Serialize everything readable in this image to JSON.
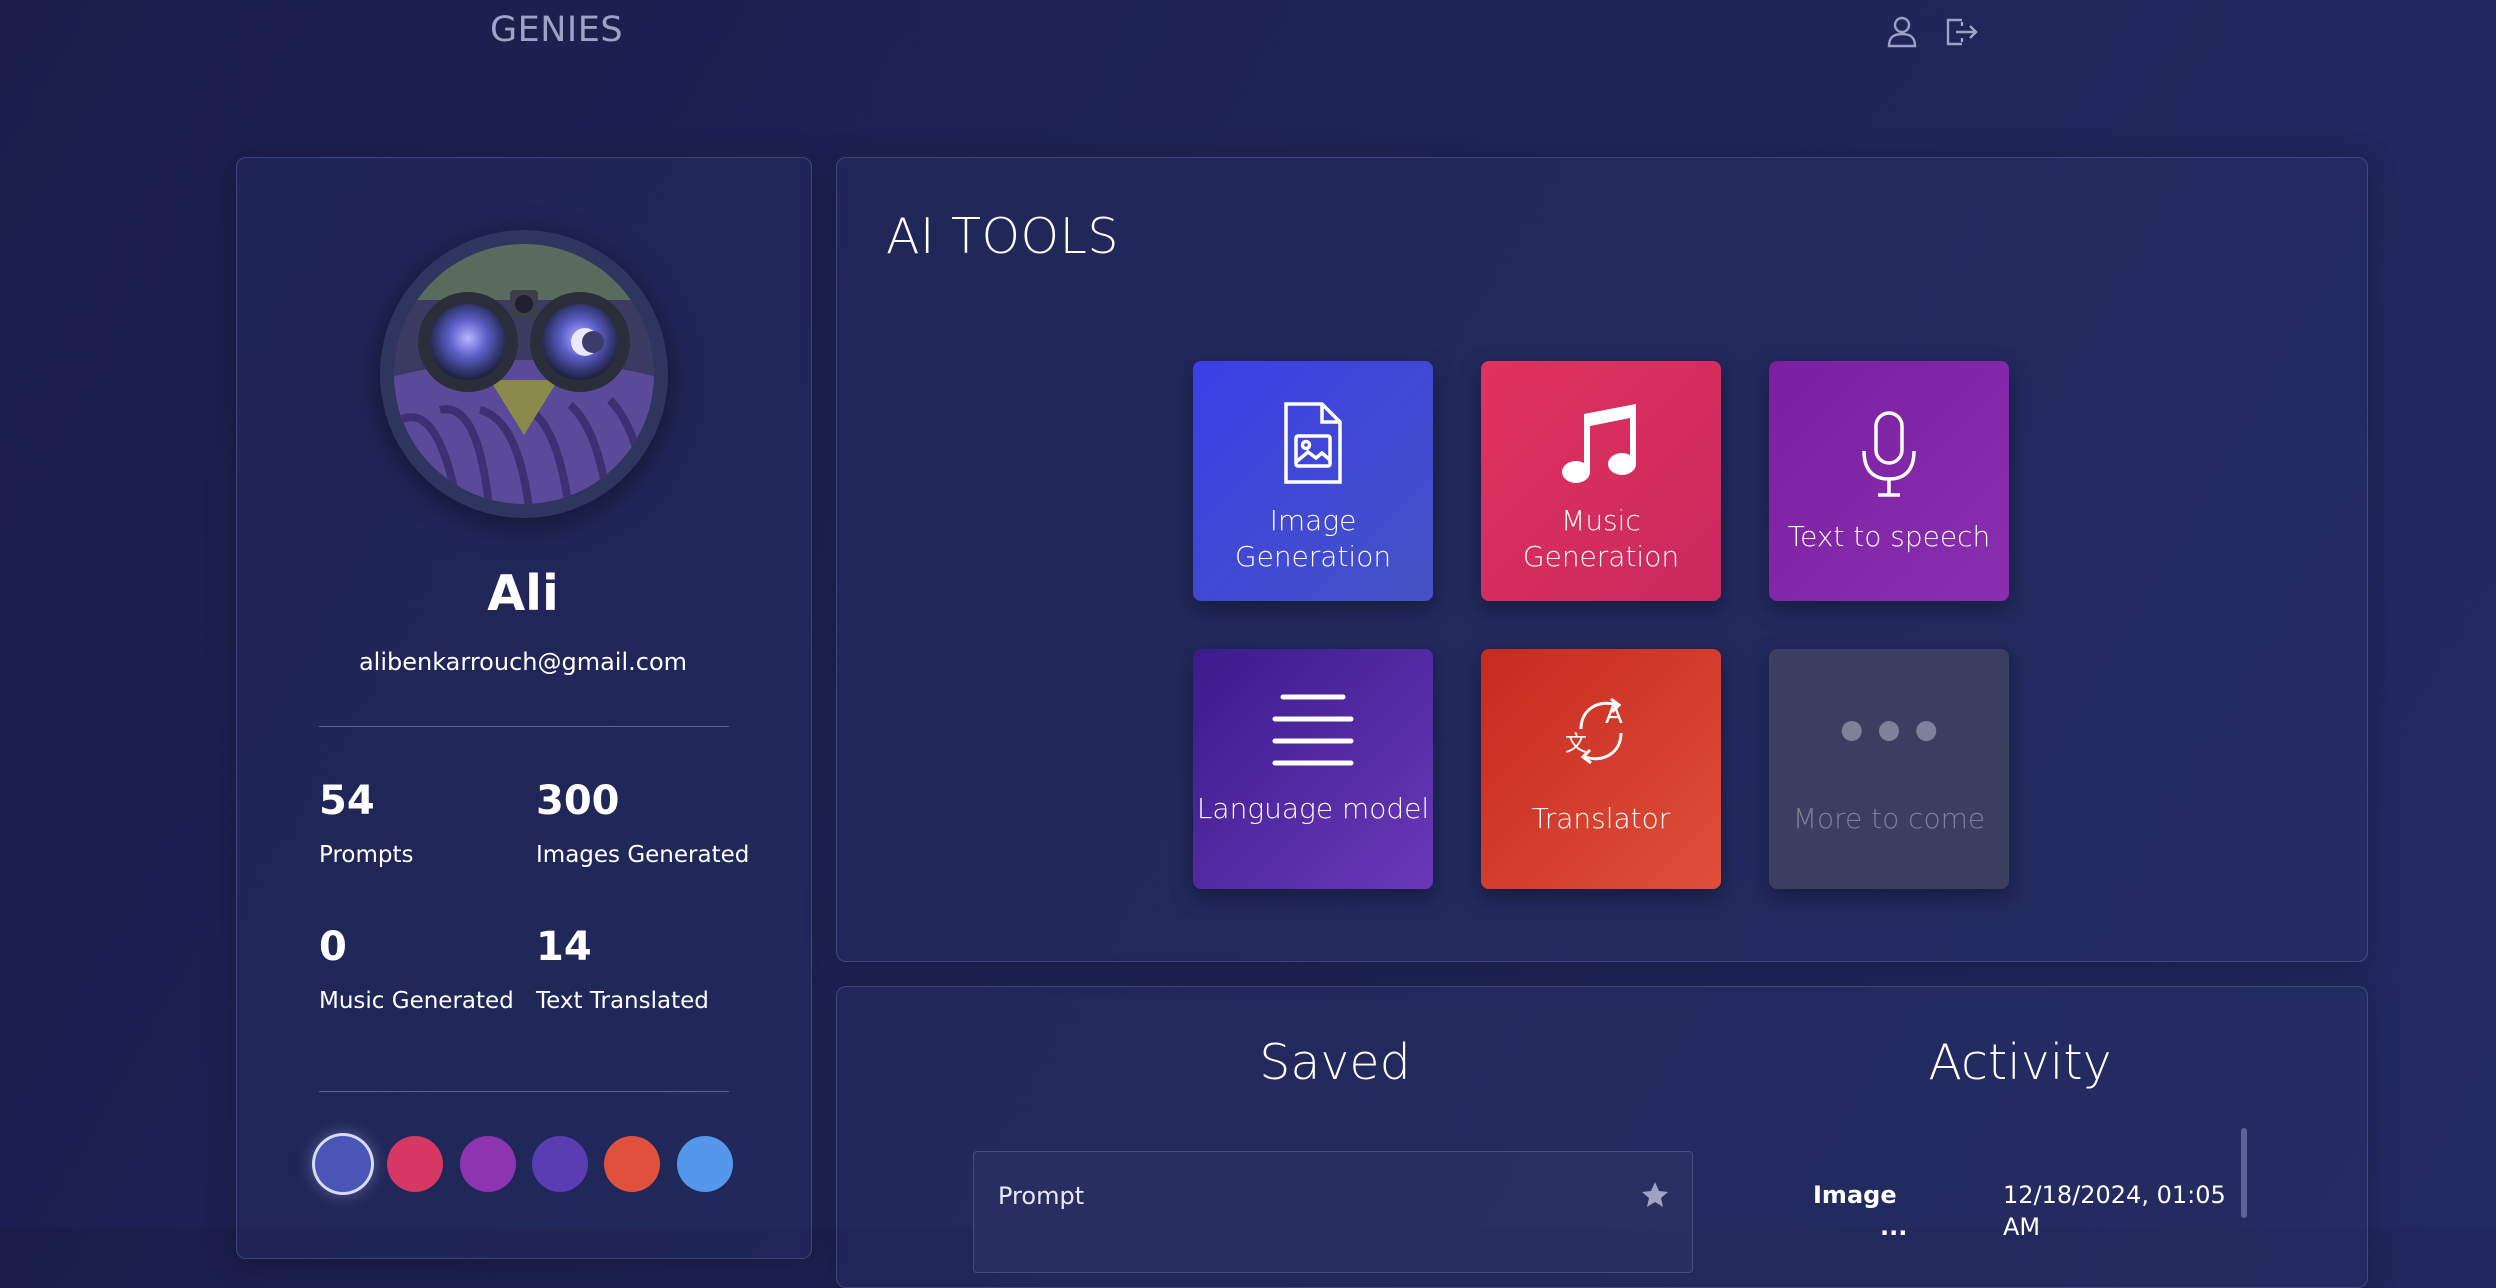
{
  "header": {
    "brand": "GENIES",
    "icons": [
      "user-icon",
      "logout-icon"
    ]
  },
  "profile": {
    "name": "Ali",
    "email": "alibenkarrouch@gmail.com",
    "stats": [
      {
        "value": "54",
        "label": "Prompts"
      },
      {
        "value": "300",
        "label": "Images Generated"
      },
      {
        "value": "0",
        "label": "Music Generated"
      },
      {
        "value": "14",
        "label": "Text Translated"
      }
    ],
    "theme_colors": [
      "#4a55b8",
      "#d63763",
      "#8e34b0",
      "#5a3db2",
      "#e0513d",
      "#5597ec"
    ],
    "selected_theme_index": 0
  },
  "tools": {
    "title": "AI TOOLS",
    "items": [
      {
        "label": "Image Generation",
        "icon": "image-file-icon"
      },
      {
        "label": "Music Generation",
        "icon": "music-note-icon"
      },
      {
        "label": "Text to speech",
        "icon": "microphone-icon"
      },
      {
        "label": "Language model",
        "icon": "lines-icon"
      },
      {
        "label": "Translator",
        "icon": "translate-icon"
      },
      {
        "label": "More to come",
        "icon": "dots-icon"
      }
    ]
  },
  "saved": {
    "title": "Saved",
    "card_label": "Prompt",
    "star_icon": "star-icon"
  },
  "activity": {
    "title": "Activity",
    "rows": [
      {
        "type": "Image",
        "date": "12/18/2024, 01:05"
      },
      {
        "type": "...",
        "date": "AM"
      }
    ]
  }
}
